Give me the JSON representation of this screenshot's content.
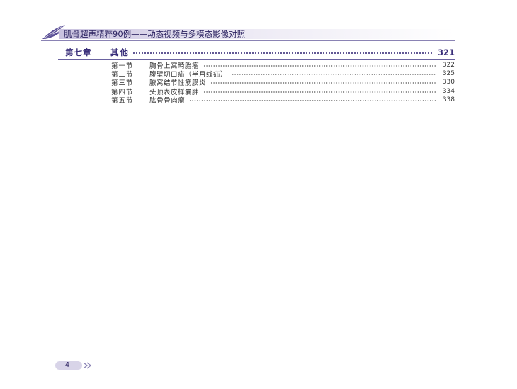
{
  "header": {
    "title": "肌骨超声精粹90例——动态视频与多模态影像对照",
    "accent_color": "#2b2260",
    "logo_icon": "feather-pen-icon"
  },
  "chapter": {
    "number": "第七章",
    "title": "其他",
    "page": "321"
  },
  "sections": [
    {
      "number": "第一节",
      "title": "胸骨上窝畸胎瘤",
      "page": "322"
    },
    {
      "number": "第二节",
      "title": "腹壁切口疝（半月线疝）",
      "page": "325"
    },
    {
      "number": "第三节",
      "title": "腋窝结节性筋膜炎",
      "page": "330"
    },
    {
      "number": "第四节",
      "title": "头顶表皮样囊肿",
      "page": "334"
    },
    {
      "number": "第五节",
      "title": "肱骨骨肉瘤",
      "page": "338"
    }
  ],
  "footer": {
    "page_number": "4",
    "nav_icon": "double-chevron-right-icon"
  }
}
